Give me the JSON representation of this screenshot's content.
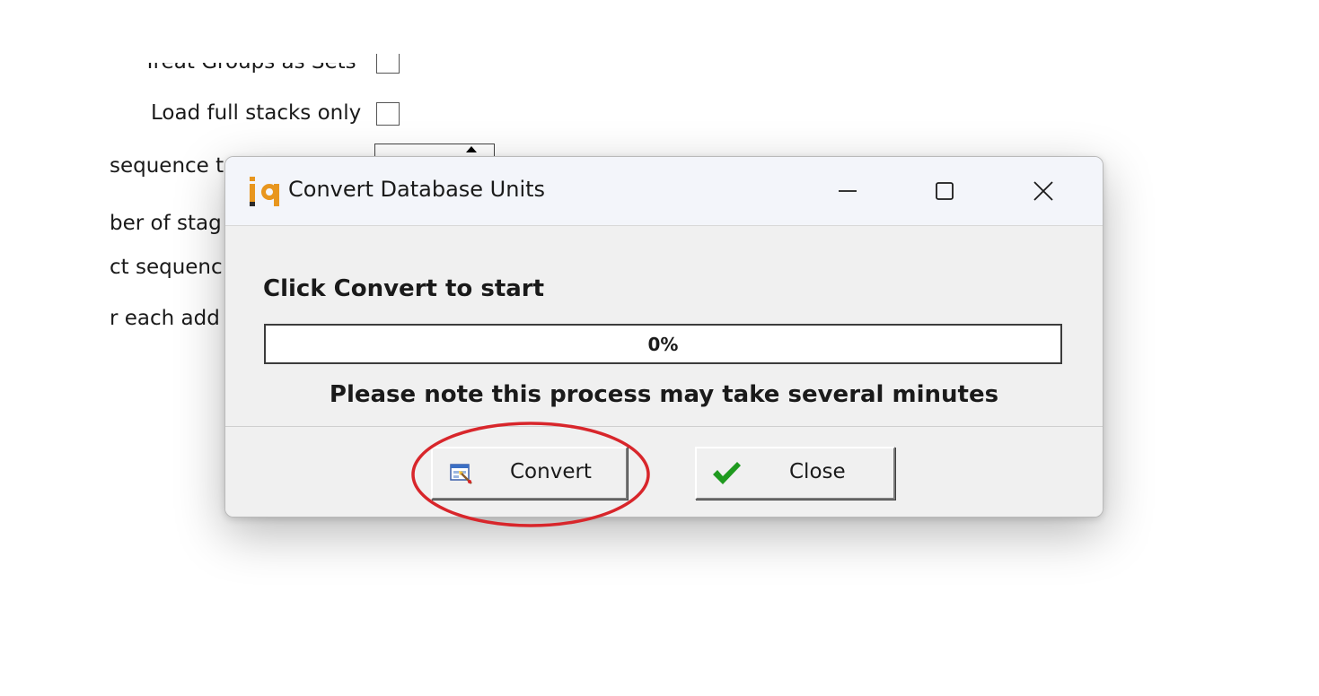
{
  "background_panel": {
    "row_cut_label": "Treat Groups as Sets",
    "full_stacks_label": "Load full stacks only",
    "sequence_label": "sequence t",
    "stages_label": "ber of stag",
    "select_sequence_label": "ct sequenc",
    "each_add_label": "r each add"
  },
  "dialog": {
    "title": "Convert Database Units",
    "heading": "Click Convert to start",
    "progress": {
      "percent": 0,
      "label": "0%"
    },
    "note": "Please note this process may take several minutes",
    "convert_button_label": "Convert",
    "close_button_label": "Close",
    "icons": {
      "app": "iq-app-icon",
      "minimize": "minimize-icon",
      "maximize": "maximize-icon",
      "close": "close-icon",
      "convert": "convert-icon",
      "checkmark": "checkmark-icon"
    }
  },
  "colors": {
    "app_icon_orange": "#e8961e",
    "annotation_red": "#d8262b",
    "checkmark_green": "#1f9a1f"
  }
}
